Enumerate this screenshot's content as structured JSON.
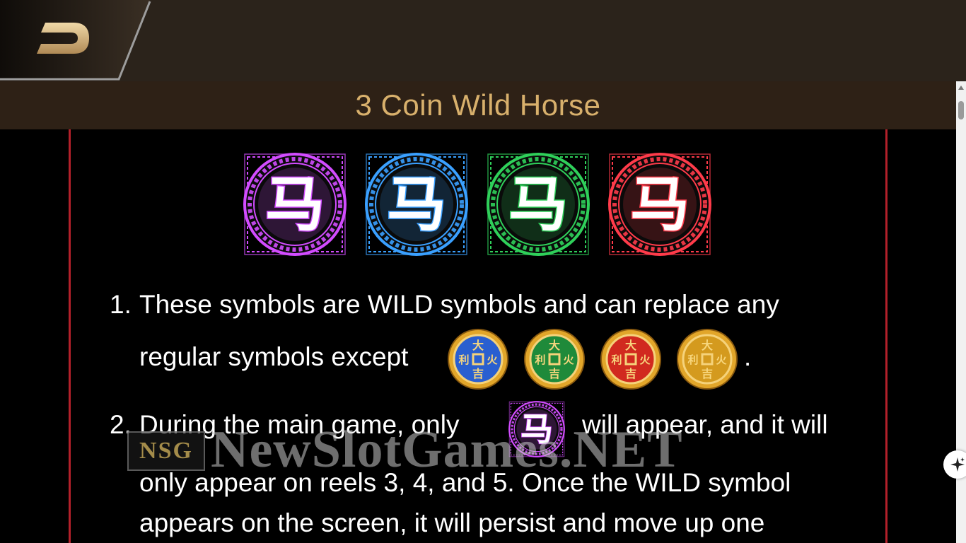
{
  "header": {
    "back_icon": "back-arrow-icon"
  },
  "title": "3 Coin Wild Horse",
  "wild_symbols": [
    {
      "name": "purple-horse-wild",
      "glyph": "马",
      "color": "#d24cff"
    },
    {
      "name": "blue-horse-wild",
      "glyph": "马",
      "color": "#3aa0ff"
    },
    {
      "name": "green-horse-wild",
      "glyph": "马",
      "color": "#2fd05a"
    },
    {
      "name": "red-horse-wild",
      "glyph": "马",
      "color": "#ff3b4a"
    }
  ],
  "rules": {
    "rule1_num": "1.",
    "rule1_line1": "These symbols are WILD symbols and can replace any",
    "rule1_line2": "regular symbols except",
    "rule1_end": ".",
    "rule2_num": "2.",
    "rule2_line1a": "During the main game, only",
    "rule2_line1b": "will appear, and it will",
    "rule2_line2": "only appear on reels 3, 4, and 5. Once the WILD symbol",
    "rule2_line3": "appears on the screen, it will persist and move up one"
  },
  "coins": [
    {
      "name": "blue-coin",
      "color": "#2a5fd0"
    },
    {
      "name": "green-coin",
      "color": "#1f8a3a"
    },
    {
      "name": "red-coin",
      "color": "#d12a1f"
    },
    {
      "name": "gold-coin",
      "color": "#d49a1e"
    }
  ],
  "coin_glyphs": {
    "top": "大",
    "left": "利",
    "right": "火",
    "bottom": "吉"
  },
  "watermark": {
    "logo": "NSG",
    "text": "NewSlotGames.NET"
  },
  "side_button_icon": "sparkle-icon"
}
